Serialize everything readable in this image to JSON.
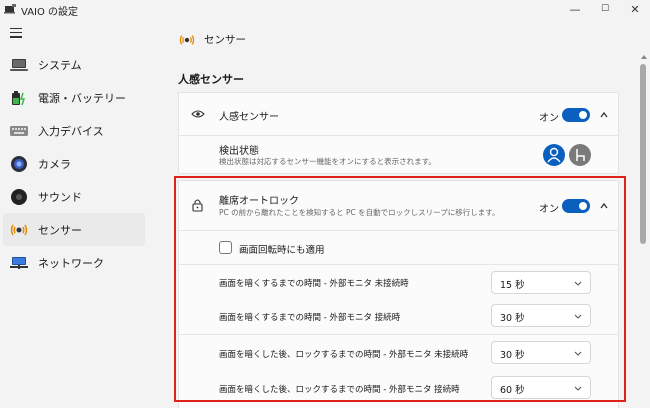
{
  "window": {
    "title": "VAIO の設定",
    "minimize": "—",
    "maximize": "☐",
    "close": "✕"
  },
  "sidebar": {
    "items": [
      {
        "label": "システム",
        "icon": "laptop-icon"
      },
      {
        "label": "電源・バッテリー",
        "icon": "battery-icon"
      },
      {
        "label": "入力デバイス",
        "icon": "keyboard-icon"
      },
      {
        "label": "カメラ",
        "icon": "camera-icon"
      },
      {
        "label": "サウンド",
        "icon": "speaker-icon"
      },
      {
        "label": "センサー",
        "icon": "sensor-icon",
        "active": true
      },
      {
        "label": "ネットワーク",
        "icon": "network-icon"
      }
    ]
  },
  "main": {
    "page_title": "センサー",
    "section_title": "人感センサー",
    "presence_card": {
      "title": "人感センサー",
      "toggle_label": "オン",
      "detect_title": "検出状態",
      "detect_desc": "検出状態は対応するセンサー機能をオンにすると表示されます。"
    },
    "lock_card": {
      "title": "離席オートロック",
      "desc": "PC の前から離れたことを検知すると PC を自動でロックしスリープに移行します。",
      "toggle_label": "オン",
      "checkbox_label": "画面回転時にも適用",
      "rows": [
        {
          "label": "画面を暗くするまでの時間 - 外部モニタ 未接続時",
          "value": "15 秒"
        },
        {
          "label": "画面を暗くするまでの時間 - 外部モニタ 接続時",
          "value": "30 秒"
        },
        {
          "label": "画面を暗くした後、ロックするまでの時間 - 外部モニタ 未接続時",
          "value": "30 秒"
        },
        {
          "label": "画面を暗くした後、ロックするまでの時間 - 外部モニタ 接続時",
          "value": "60 秒"
        }
      ]
    }
  },
  "colors": {
    "accent": "#0a5fbf",
    "highlight": "#e01f1f"
  }
}
